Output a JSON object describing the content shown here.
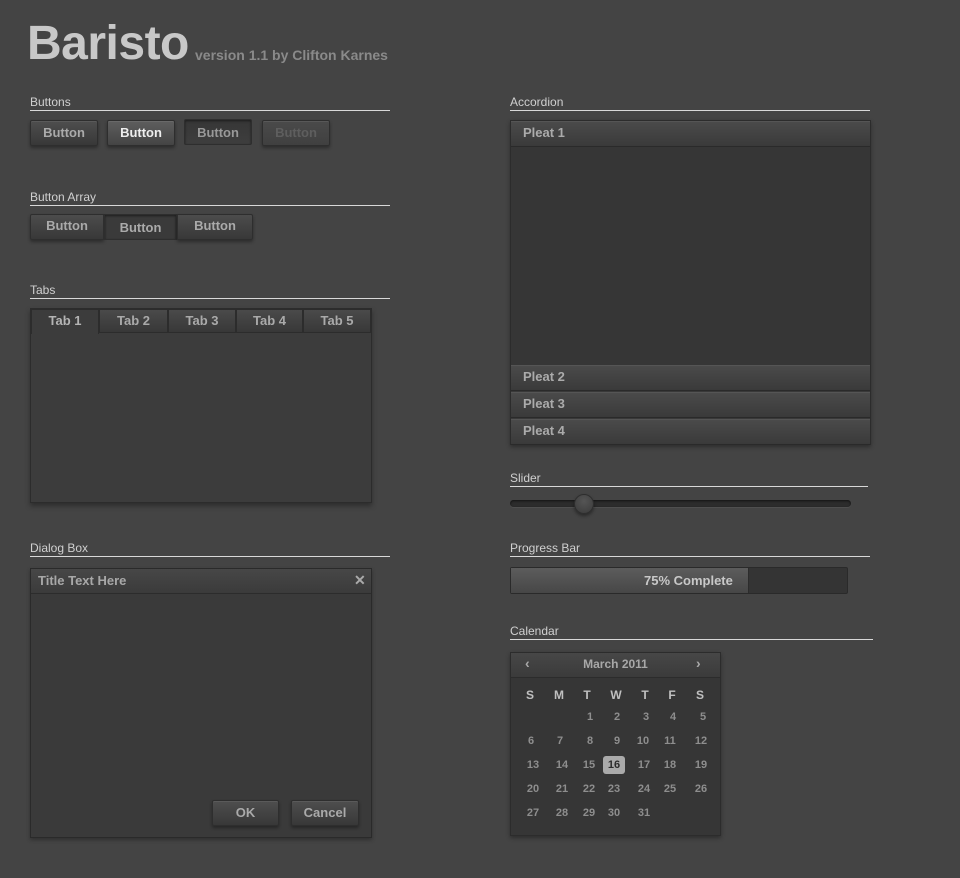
{
  "header": {
    "title": "Baristo",
    "subtitle": "version 1.1 by Clifton Karnes"
  },
  "sections": {
    "buttons": "Buttons",
    "button_array": "Button Array",
    "tabs": "Tabs",
    "dialog": "Dialog Box",
    "accordion": "Accordion",
    "slider": "Slider",
    "progress": "Progress Bar",
    "calendar": "Calendar"
  },
  "buttons": [
    {
      "label": "Button",
      "state": "normal"
    },
    {
      "label": "Button",
      "state": "hover"
    },
    {
      "label": "Button",
      "state": "pressed"
    },
    {
      "label": "Button",
      "state": "disabled"
    }
  ],
  "button_array": [
    {
      "label": "Button",
      "state": "normal"
    },
    {
      "label": "Button",
      "state": "pressed"
    },
    {
      "label": "Button",
      "state": "normal"
    }
  ],
  "tabs": {
    "items": [
      "Tab 1",
      "Tab 2",
      "Tab 3",
      "Tab 4",
      "Tab 5"
    ],
    "active": "Tab 1"
  },
  "dialog": {
    "title": "Title Text Here",
    "close_icon": "close-icon",
    "ok_label": "OK",
    "cancel_label": "Cancel"
  },
  "accordion": {
    "pleats": [
      "Pleat 1",
      "Pleat 2",
      "Pleat 3",
      "Pleat 4"
    ],
    "expanded": "Pleat 1"
  },
  "slider": {
    "value": 0.2
  },
  "progress": {
    "value": 0.75,
    "label": "75% Complete"
  },
  "calendar": {
    "month_label": "March 2011",
    "prev_icon": "chevron-left-icon",
    "next_icon": "chevron-right-icon",
    "weekdays": [
      "S",
      "M",
      "T",
      "W",
      "T",
      "F",
      "S"
    ],
    "weeks": [
      [
        "",
        "",
        "1",
        "2",
        "3",
        "4",
        "5"
      ],
      [
        "6",
        "7",
        "8",
        "9",
        "10",
        "11",
        "12"
      ],
      [
        "13",
        "14",
        "15",
        "16",
        "17",
        "18",
        "19"
      ],
      [
        "20",
        "21",
        "22",
        "23",
        "24",
        "25",
        "26"
      ],
      [
        "27",
        "28",
        "29",
        "30",
        "31",
        "",
        ""
      ]
    ],
    "selected_day": "16"
  },
  "colors": {
    "background": "#444444",
    "panel": "#3a3a3a",
    "text": "#aaaaaa",
    "selected_day": "#aaaaaa"
  }
}
